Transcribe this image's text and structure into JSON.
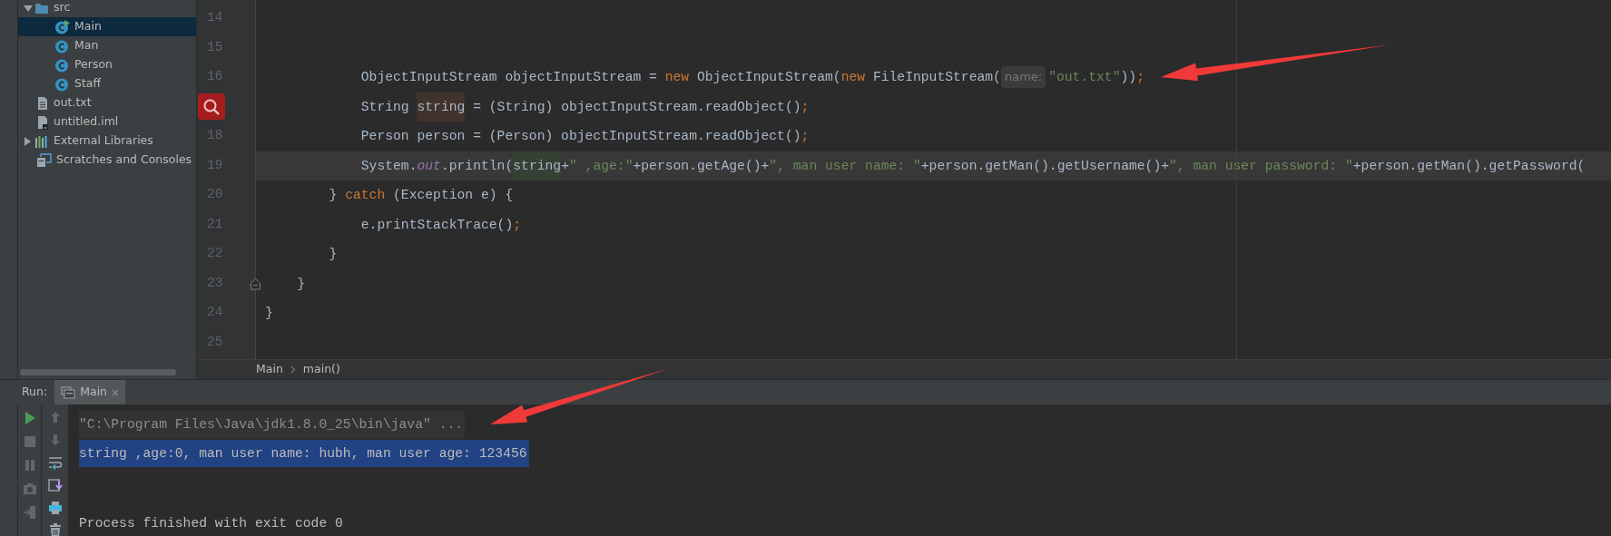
{
  "project_tree": [
    {
      "label": "src",
      "kind": "folder",
      "selected": false,
      "expanded": true,
      "children": [
        {
          "label": "Main",
          "kind": "class",
          "selected": true,
          "runnable": true
        },
        {
          "label": "Man",
          "kind": "class",
          "selected": false,
          "runnable": false
        },
        {
          "label": "Person",
          "kind": "class",
          "selected": false,
          "runnable": false
        },
        {
          "label": "Staff",
          "kind": "class",
          "selected": false,
          "runnable": false
        }
      ]
    },
    {
      "label": "out.txt",
      "kind": "text_file",
      "selected": false
    },
    {
      "label": "untitled.iml",
      "kind": "module_file",
      "selected": false
    },
    {
      "label": "External Libraries",
      "kind": "libraries",
      "selected": false,
      "expanded": false
    },
    {
      "label": "Scratches and Consoles",
      "kind": "scratches",
      "selected": false
    }
  ],
  "editor": {
    "lines": [
      {
        "number": "14",
        "current": false
      },
      {
        "number": "15",
        "current": false
      },
      {
        "number": "16",
        "current": false,
        "annotated": true,
        "tokens": [
          {
            "text": "            ObjectInputStream objectInputStream = ",
            "kind": "plain"
          },
          {
            "text": "new",
            "kind": "keyword"
          },
          {
            "text": " ObjectInputStream(",
            "kind": "plain"
          },
          {
            "text": "new",
            "kind": "keyword"
          },
          {
            "text": " FileInputStream(",
            "kind": "plain"
          },
          {
            "text": "name:",
            "kind": "hint"
          },
          {
            "text": "\"out.txt\"",
            "kind": "string"
          },
          {
            "text": "))",
            "kind": "plain"
          },
          {
            "text": ";",
            "kind": "keyword"
          }
        ]
      },
      {
        "search_marker": true,
        "current": false,
        "tokens": [
          {
            "text": "            String ",
            "kind": "plain"
          },
          {
            "text": "string",
            "kind": "write_usage"
          },
          {
            "text": " = (String) objectInputStream.readObject()",
            "kind": "plain"
          },
          {
            "text": ";",
            "kind": "keyword"
          }
        ]
      },
      {
        "number": "18",
        "current": false,
        "tokens": [
          {
            "text": "            Person person = (Person) objectInputStream.readObject()",
            "kind": "plain"
          },
          {
            "text": ";",
            "kind": "keyword"
          }
        ]
      },
      {
        "number": "19",
        "current": true,
        "tokens": [
          {
            "text": "            System.",
            "kind": "plain"
          },
          {
            "text": "out",
            "kind": "static_field"
          },
          {
            "text": ".println(",
            "kind": "plain"
          },
          {
            "text": "string",
            "kind": "read_usage"
          },
          {
            "text": "+",
            "kind": "plain"
          },
          {
            "text": "\" ,age:\"",
            "kind": "string"
          },
          {
            "text": "+person.getAge()+",
            "kind": "plain"
          },
          {
            "text": "\", man user name: \"",
            "kind": "string"
          },
          {
            "text": "+person.getMan().getUsername()+",
            "kind": "plain"
          },
          {
            "text": "\", man user password: \"",
            "kind": "string"
          },
          {
            "text": "+person.getMan().getPassword(",
            "kind": "plain"
          }
        ]
      },
      {
        "number": "20",
        "current": false,
        "tokens": [
          {
            "text": "        } ",
            "kind": "plain"
          },
          {
            "text": "catch",
            "kind": "keyword"
          },
          {
            "text": " (Exception e) {",
            "kind": "plain"
          }
        ]
      },
      {
        "number": "21",
        "current": false,
        "tokens": [
          {
            "text": "            e.printStackTrace()",
            "kind": "plain"
          },
          {
            "text": ";",
            "kind": "keyword"
          }
        ]
      },
      {
        "number": "22",
        "current": false,
        "tokens": [
          {
            "text": "        }",
            "kind": "plain"
          }
        ]
      },
      {
        "number": "23",
        "current": false,
        "fold_marker": true,
        "tokens": [
          {
            "text": "    }",
            "kind": "plain"
          }
        ]
      },
      {
        "number": "24",
        "current": false,
        "tokens": [
          {
            "text": "}",
            "kind": "plain"
          }
        ]
      },
      {
        "number": "25",
        "current": false
      }
    ]
  },
  "breadcrumbs": [
    "Main",
    "main()"
  ],
  "run_panel": {
    "label": "Run:",
    "tabs": [
      {
        "label": "Main",
        "selected": true
      }
    ],
    "toolbar_left": [
      {
        "kind": "run",
        "disabled": false
      },
      {
        "kind": "stop",
        "disabled": true
      },
      {
        "kind": "pause",
        "disabled": true
      },
      {
        "kind": "camera",
        "disabled": true
      },
      {
        "kind": "exit",
        "disabled": true
      }
    ],
    "toolbar_right": [
      {
        "kind": "up",
        "disabled": true
      },
      {
        "kind": "down",
        "disabled": true
      },
      {
        "kind": "soft_wrap",
        "disabled": false
      },
      {
        "kind": "scroll_end",
        "disabled": false
      },
      {
        "kind": "print",
        "disabled": false
      },
      {
        "kind": "trash",
        "disabled": false
      }
    ],
    "console": [
      {
        "text": "\"C:\\Program Files\\Java\\jdk1.8.0_25\\bin\\java\" ...",
        "kind": "command",
        "selected": false,
        "annotated": true
      },
      {
        "text": "string ,age:0, man user name: hubh, man user age: 123456",
        "kind": "output",
        "selected": true,
        "annotated": false
      },
      {
        "text": "Process finished with exit code 0",
        "kind": "system",
        "selected": false,
        "annotated": false
      }
    ]
  }
}
